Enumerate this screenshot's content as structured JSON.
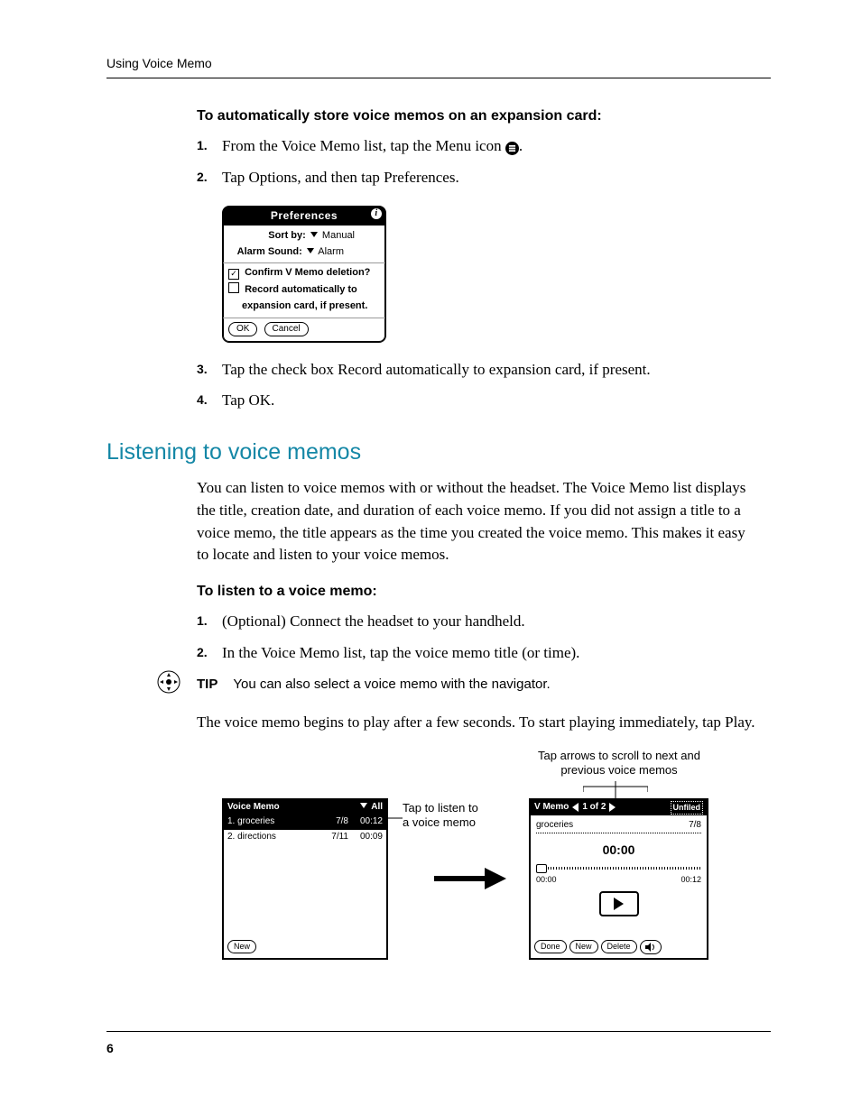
{
  "running_head": "Using Voice Memo",
  "page_number": "6",
  "sec1": {
    "subhead": "To automatically store voice memos on an expansion card:",
    "steps": {
      "1a": "From the Voice Memo list, tap the Menu icon ",
      "1b": ".",
      "2": "Tap Options, and then tap Preferences.",
      "3": "Tap the check box Record automatically to expansion card, if present.",
      "4": "Tap OK."
    }
  },
  "pref": {
    "title": "Preferences",
    "sortby_label": "Sort by:",
    "sortby_value": "Manual",
    "alarm_label": "Alarm Sound:",
    "alarm_value": "Alarm",
    "chk1": "Confirm V Memo deletion?",
    "chk2a": "Record automatically to",
    "chk2b": "expansion card, if present.",
    "ok": "OK",
    "cancel": "Cancel"
  },
  "h2": "Listening to voice memos",
  "para1": "You can listen to voice memos with or without the headset. The Voice Memo list displays the title, creation date, and duration of each voice memo. If you did not assign a title to a voice memo, the title appears as the time you created the voice memo. This makes it easy to locate and listen to your voice memos.",
  "sec2": {
    "subhead": "To listen to a voice memo:",
    "steps": {
      "1": "(Optional) Connect the headset to your handheld.",
      "2": "In the Voice Memo list, tap the voice memo title (or time)."
    }
  },
  "tip": {
    "label": "TIP",
    "text": "You can also select a voice memo with the navigator."
  },
  "para2": "The voice memo begins to play after a few seconds. To start playing immediately, tap Play.",
  "fig": {
    "captions": {
      "top": "Tap arrows to scroll to next and previous voice memos",
      "side": "Tap to listen to a voice memo"
    },
    "list": {
      "title": "Voice Memo",
      "category": "All",
      "rows": [
        {
          "n": "1.",
          "title": "groceries",
          "date": "7/8",
          "dur": "00:12"
        },
        {
          "n": "2.",
          "title": "directions",
          "date": "7/11",
          "dur": "00:09"
        }
      ],
      "new": "New"
    },
    "player": {
      "title": "V Memo",
      "index": "1 of 2",
      "category": "Unfiled",
      "memo_title": "groceries",
      "memo_date": "7/8",
      "elapsed": "00:00",
      "start": "00:00",
      "end": "00:12",
      "done": "Done",
      "new": "New",
      "delete": "Delete"
    }
  }
}
